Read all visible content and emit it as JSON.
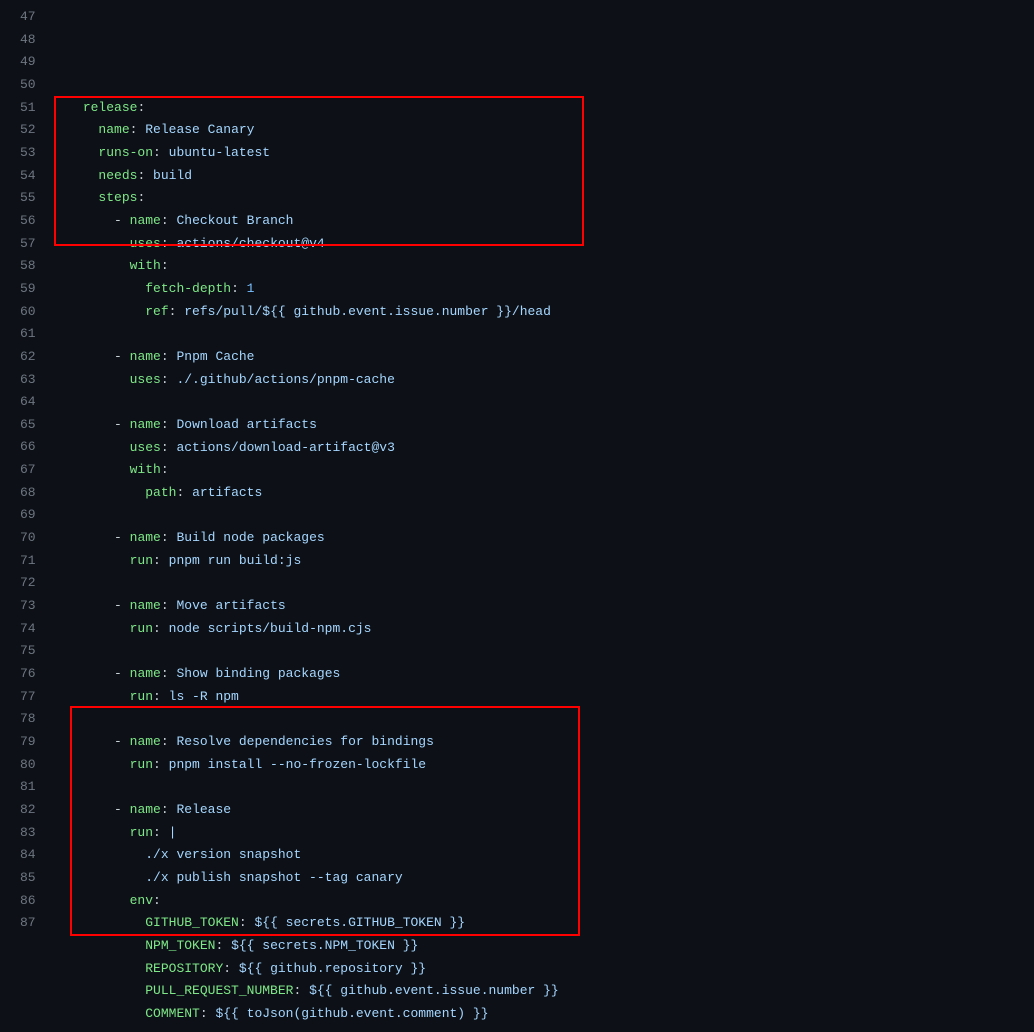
{
  "lineNumbers": [
    "47",
    "48",
    "49",
    "50",
    "51",
    "52",
    "53",
    "54",
    "55",
    "56",
    "57",
    "58",
    "59",
    "60",
    "61",
    "62",
    "63",
    "64",
    "65",
    "66",
    "67",
    "68",
    "69",
    "70",
    "71",
    "72",
    "73",
    "74",
    "75",
    "76",
    "77",
    "78",
    "79",
    "80",
    "81",
    "82",
    "83",
    "84",
    "85",
    "86",
    "87"
  ],
  "codeLines": [
    {
      "indent": 4,
      "tokens": [
        {
          "t": "release",
          "c": "k"
        },
        {
          "t": ":",
          "c": "p"
        }
      ]
    },
    {
      "indent": 6,
      "tokens": [
        {
          "t": "name",
          "c": "k"
        },
        {
          "t": ": ",
          "c": "p"
        },
        {
          "t": "Release Canary",
          "c": "s"
        }
      ]
    },
    {
      "indent": 6,
      "tokens": [
        {
          "t": "runs-on",
          "c": "k"
        },
        {
          "t": ": ",
          "c": "p"
        },
        {
          "t": "ubuntu-latest",
          "c": "s"
        }
      ]
    },
    {
      "indent": 6,
      "tokens": [
        {
          "t": "needs",
          "c": "k"
        },
        {
          "t": ": ",
          "c": "p"
        },
        {
          "t": "build",
          "c": "s"
        }
      ]
    },
    {
      "indent": 6,
      "tokens": [
        {
          "t": "steps",
          "c": "k"
        },
        {
          "t": ":",
          "c": "p"
        }
      ]
    },
    {
      "indent": 8,
      "tokens": [
        {
          "t": "- ",
          "c": "d"
        },
        {
          "t": "name",
          "c": "k"
        },
        {
          "t": ": ",
          "c": "p"
        },
        {
          "t": "Checkout Branch",
          "c": "s"
        }
      ]
    },
    {
      "indent": 10,
      "tokens": [
        {
          "t": "uses",
          "c": "k"
        },
        {
          "t": ": ",
          "c": "p"
        },
        {
          "t": "actions/checkout@v4",
          "c": "s"
        }
      ]
    },
    {
      "indent": 10,
      "tokens": [
        {
          "t": "with",
          "c": "k"
        },
        {
          "t": ":",
          "c": "p"
        }
      ]
    },
    {
      "indent": 12,
      "tokens": [
        {
          "t": "fetch-depth",
          "c": "k"
        },
        {
          "t": ": ",
          "c": "p"
        },
        {
          "t": "1",
          "c": "n"
        }
      ]
    },
    {
      "indent": 12,
      "tokens": [
        {
          "t": "ref",
          "c": "k"
        },
        {
          "t": ": ",
          "c": "p"
        },
        {
          "t": "refs/pull/${{ github.event.issue.number }}/head",
          "c": "s"
        }
      ]
    },
    {
      "indent": 0,
      "tokens": []
    },
    {
      "indent": 8,
      "tokens": [
        {
          "t": "- ",
          "c": "d"
        },
        {
          "t": "name",
          "c": "k"
        },
        {
          "t": ": ",
          "c": "p"
        },
        {
          "t": "Pnpm Cache",
          "c": "s"
        }
      ]
    },
    {
      "indent": 10,
      "tokens": [
        {
          "t": "uses",
          "c": "k"
        },
        {
          "t": ": ",
          "c": "p"
        },
        {
          "t": "./.github/actions/pnpm-cache",
          "c": "s"
        }
      ]
    },
    {
      "indent": 0,
      "tokens": []
    },
    {
      "indent": 8,
      "tokens": [
        {
          "t": "- ",
          "c": "d"
        },
        {
          "t": "name",
          "c": "k"
        },
        {
          "t": ": ",
          "c": "p"
        },
        {
          "t": "Download artifacts",
          "c": "s"
        }
      ]
    },
    {
      "indent": 10,
      "tokens": [
        {
          "t": "uses",
          "c": "k"
        },
        {
          "t": ": ",
          "c": "p"
        },
        {
          "t": "actions/download-artifact@v3",
          "c": "s"
        }
      ]
    },
    {
      "indent": 10,
      "tokens": [
        {
          "t": "with",
          "c": "k"
        },
        {
          "t": ":",
          "c": "p"
        }
      ]
    },
    {
      "indent": 12,
      "tokens": [
        {
          "t": "path",
          "c": "k"
        },
        {
          "t": ": ",
          "c": "p"
        },
        {
          "t": "artifacts",
          "c": "s"
        }
      ]
    },
    {
      "indent": 0,
      "tokens": []
    },
    {
      "indent": 8,
      "tokens": [
        {
          "t": "- ",
          "c": "d"
        },
        {
          "t": "name",
          "c": "k"
        },
        {
          "t": ": ",
          "c": "p"
        },
        {
          "t": "Build node packages",
          "c": "s"
        }
      ]
    },
    {
      "indent": 10,
      "tokens": [
        {
          "t": "run",
          "c": "k"
        },
        {
          "t": ": ",
          "c": "p"
        },
        {
          "t": "pnpm run build:js",
          "c": "s"
        }
      ]
    },
    {
      "indent": 0,
      "tokens": []
    },
    {
      "indent": 8,
      "tokens": [
        {
          "t": "- ",
          "c": "d"
        },
        {
          "t": "name",
          "c": "k"
        },
        {
          "t": ": ",
          "c": "p"
        },
        {
          "t": "Move artifacts",
          "c": "s"
        }
      ]
    },
    {
      "indent": 10,
      "tokens": [
        {
          "t": "run",
          "c": "k"
        },
        {
          "t": ": ",
          "c": "p"
        },
        {
          "t": "node scripts/build-npm.cjs",
          "c": "s"
        }
      ]
    },
    {
      "indent": 0,
      "tokens": []
    },
    {
      "indent": 8,
      "tokens": [
        {
          "t": "- ",
          "c": "d"
        },
        {
          "t": "name",
          "c": "k"
        },
        {
          "t": ": ",
          "c": "p"
        },
        {
          "t": "Show binding packages",
          "c": "s"
        }
      ]
    },
    {
      "indent": 10,
      "tokens": [
        {
          "t": "run",
          "c": "k"
        },
        {
          "t": ": ",
          "c": "p"
        },
        {
          "t": "ls -R npm",
          "c": "s"
        }
      ]
    },
    {
      "indent": 0,
      "tokens": []
    },
    {
      "indent": 8,
      "tokens": [
        {
          "t": "- ",
          "c": "d"
        },
        {
          "t": "name",
          "c": "k"
        },
        {
          "t": ": ",
          "c": "p"
        },
        {
          "t": "Resolve dependencies for bindings",
          "c": "s"
        }
      ]
    },
    {
      "indent": 10,
      "tokens": [
        {
          "t": "run",
          "c": "k"
        },
        {
          "t": ": ",
          "c": "p"
        },
        {
          "t": "pnpm install --no-frozen-lockfile",
          "c": "s"
        }
      ]
    },
    {
      "indent": 0,
      "tokens": []
    },
    {
      "indent": 8,
      "tokens": [
        {
          "t": "- ",
          "c": "d"
        },
        {
          "t": "name",
          "c": "k"
        },
        {
          "t": ": ",
          "c": "p"
        },
        {
          "t": "Release",
          "c": "s"
        }
      ]
    },
    {
      "indent": 10,
      "tokens": [
        {
          "t": "run",
          "c": "k"
        },
        {
          "t": ": ",
          "c": "p"
        },
        {
          "t": "|",
          "c": "s"
        }
      ]
    },
    {
      "indent": 12,
      "tokens": [
        {
          "t": "./x version snapshot",
          "c": "s"
        }
      ]
    },
    {
      "indent": 12,
      "tokens": [
        {
          "t": "./x publish snapshot --tag canary",
          "c": "s"
        }
      ]
    },
    {
      "indent": 10,
      "tokens": [
        {
          "t": "env",
          "c": "k"
        },
        {
          "t": ":",
          "c": "p"
        }
      ]
    },
    {
      "indent": 12,
      "tokens": [
        {
          "t": "GITHUB_TOKEN",
          "c": "k"
        },
        {
          "t": ": ",
          "c": "p"
        },
        {
          "t": "${{ secrets.GITHUB_TOKEN }}",
          "c": "s"
        }
      ]
    },
    {
      "indent": 12,
      "tokens": [
        {
          "t": "NPM_TOKEN",
          "c": "k"
        },
        {
          "t": ": ",
          "c": "p"
        },
        {
          "t": "${{ secrets.NPM_TOKEN }}",
          "c": "s"
        }
      ]
    },
    {
      "indent": 12,
      "tokens": [
        {
          "t": "REPOSITORY",
          "c": "k"
        },
        {
          "t": ": ",
          "c": "p"
        },
        {
          "t": "${{ github.repository }}",
          "c": "s"
        }
      ]
    },
    {
      "indent": 12,
      "tokens": [
        {
          "t": "PULL_REQUEST_NUMBER",
          "c": "k"
        },
        {
          "t": ": ",
          "c": "p"
        },
        {
          "t": "${{ github.event.issue.number }}",
          "c": "s"
        }
      ]
    },
    {
      "indent": 12,
      "tokens": [
        {
          "t": "COMMENT",
          "c": "k"
        },
        {
          "t": ": ",
          "c": "p"
        },
        {
          "t": "${{ toJson(github.event.comment) }}",
          "c": "s"
        }
      ]
    }
  ]
}
